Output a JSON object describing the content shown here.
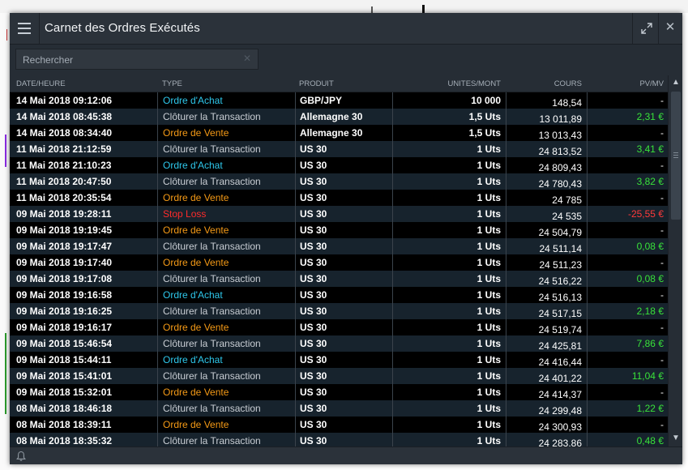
{
  "window": {
    "title": "Carnet des Ordres Exécutés",
    "close_label": "✕"
  },
  "search": {
    "placeholder": "Rechercher",
    "clear_label": "✕"
  },
  "columns": {
    "date": "DATE/HEURE",
    "type": "TYPE",
    "product": "PRODUIT",
    "units": "UNITES/MONT",
    "price": "COURS",
    "pl": "PV/MV"
  },
  "colors": {
    "buy": "#2ec8ec",
    "sell": "#f59a16",
    "stop": "#ff2b2b",
    "profit": "#39e23a"
  },
  "icons": {
    "menu": "hamburger-icon",
    "expand": "expand-icon",
    "close": "close-icon",
    "bell": "bell-icon"
  },
  "rows": [
    {
      "date": "14 Mai 2018 09:12:06",
      "type": "Ordre d'Achat",
      "kind": "buy",
      "product": "GBP/JPY",
      "units": "10 000",
      "price": "148,54",
      "pl": "-",
      "pl_kind": "none"
    },
    {
      "date": "14 Mai 2018 08:45:38",
      "type": "Clôturer la Transaction",
      "kind": "close",
      "product": "Allemagne 30",
      "units": "1,5 Uts",
      "price": "13 011,89",
      "pl": "2,31 €",
      "pl_kind": "pos"
    },
    {
      "date": "14 Mai 2018 08:34:40",
      "type": "Ordre de Vente",
      "kind": "sell",
      "product": "Allemagne 30",
      "units": "1,5 Uts",
      "price": "13 013,43",
      "pl": "-",
      "pl_kind": "none"
    },
    {
      "date": "11 Mai 2018 21:12:59",
      "type": "Clôturer la Transaction",
      "kind": "close",
      "product": "US 30",
      "units": "1 Uts",
      "price": "24 813,52",
      "pl": "3,41 €",
      "pl_kind": "pos"
    },
    {
      "date": "11 Mai 2018 21:10:23",
      "type": "Ordre d'Achat",
      "kind": "buy",
      "product": "US 30",
      "units": "1 Uts",
      "price": "24 809,43",
      "pl": "-",
      "pl_kind": "none"
    },
    {
      "date": "11 Mai 2018 20:47:50",
      "type": "Clôturer la Transaction",
      "kind": "close",
      "product": "US 30",
      "units": "1 Uts",
      "price": "24 780,43",
      "pl": "3,82 €",
      "pl_kind": "pos"
    },
    {
      "date": "11 Mai 2018 20:35:54",
      "type": "Ordre de Vente",
      "kind": "sell",
      "product": "US 30",
      "units": "1 Uts",
      "price": "24 785",
      "pl": "-",
      "pl_kind": "none"
    },
    {
      "date": "09 Mai 2018 19:28:11",
      "type": "Stop Loss",
      "kind": "stop",
      "product": "US 30",
      "units": "1 Uts",
      "price": "24 535",
      "pl": "-25,55 €",
      "pl_kind": "neg"
    },
    {
      "date": "09 Mai 2018 19:19:45",
      "type": "Ordre de Vente",
      "kind": "sell",
      "product": "US 30",
      "units": "1 Uts",
      "price": "24 504,79",
      "pl": "-",
      "pl_kind": "none"
    },
    {
      "date": "09 Mai 2018 19:17:47",
      "type": "Clôturer la Transaction",
      "kind": "close",
      "product": "US 30",
      "units": "1 Uts",
      "price": "24 511,14",
      "pl": "0,08 €",
      "pl_kind": "pos"
    },
    {
      "date": "09 Mai 2018 19:17:40",
      "type": "Ordre de Vente",
      "kind": "sell",
      "product": "US 30",
      "units": "1 Uts",
      "price": "24 511,23",
      "pl": "-",
      "pl_kind": "none"
    },
    {
      "date": "09 Mai 2018 19:17:08",
      "type": "Clôturer la Transaction",
      "kind": "close",
      "product": "US 30",
      "units": "1 Uts",
      "price": "24 516,22",
      "pl": "0,08 €",
      "pl_kind": "pos"
    },
    {
      "date": "09 Mai 2018 19:16:58",
      "type": "Ordre d'Achat",
      "kind": "buy",
      "product": "US 30",
      "units": "1 Uts",
      "price": "24 516,13",
      "pl": "-",
      "pl_kind": "none"
    },
    {
      "date": "09 Mai 2018 19:16:25",
      "type": "Clôturer la Transaction",
      "kind": "close",
      "product": "US 30",
      "units": "1 Uts",
      "price": "24 517,15",
      "pl": "2,18 €",
      "pl_kind": "pos"
    },
    {
      "date": "09 Mai 2018 19:16:17",
      "type": "Ordre de Vente",
      "kind": "sell",
      "product": "US 30",
      "units": "1 Uts",
      "price": "24 519,74",
      "pl": "-",
      "pl_kind": "none"
    },
    {
      "date": "09 Mai 2018 15:46:54",
      "type": "Clôturer la Transaction",
      "kind": "close",
      "product": "US 30",
      "units": "1 Uts",
      "price": "24 425,81",
      "pl": "7,86 €",
      "pl_kind": "pos"
    },
    {
      "date": "09 Mai 2018 15:44:11",
      "type": "Ordre d'Achat",
      "kind": "buy",
      "product": "US 30",
      "units": "1 Uts",
      "price": "24 416,44",
      "pl": "-",
      "pl_kind": "none"
    },
    {
      "date": "09 Mai 2018 15:41:01",
      "type": "Clôturer la Transaction",
      "kind": "close",
      "product": "US 30",
      "units": "1 Uts",
      "price": "24 401,22",
      "pl": "11,04 €",
      "pl_kind": "pos"
    },
    {
      "date": "09 Mai 2018 15:32:01",
      "type": "Ordre de Vente",
      "kind": "sell",
      "product": "US 30",
      "units": "1 Uts",
      "price": "24 414,37",
      "pl": "-",
      "pl_kind": "none"
    },
    {
      "date": "08 Mai 2018 18:46:18",
      "type": "Clôturer la Transaction",
      "kind": "close",
      "product": "US 30",
      "units": "1 Uts",
      "price": "24 299,48",
      "pl": "1,22 €",
      "pl_kind": "pos"
    },
    {
      "date": "08 Mai 2018 18:39:11",
      "type": "Ordre de Vente",
      "kind": "sell",
      "product": "US 30",
      "units": "1 Uts",
      "price": "24 300,93",
      "pl": "-",
      "pl_kind": "none"
    },
    {
      "date": "08 Mai 2018 18:35:32",
      "type": "Clôturer la Transaction",
      "kind": "close",
      "product": "US 30",
      "units": "1 Uts",
      "price": "24 283,86",
      "pl": "0,48 €",
      "pl_kind": "pos"
    }
  ]
}
